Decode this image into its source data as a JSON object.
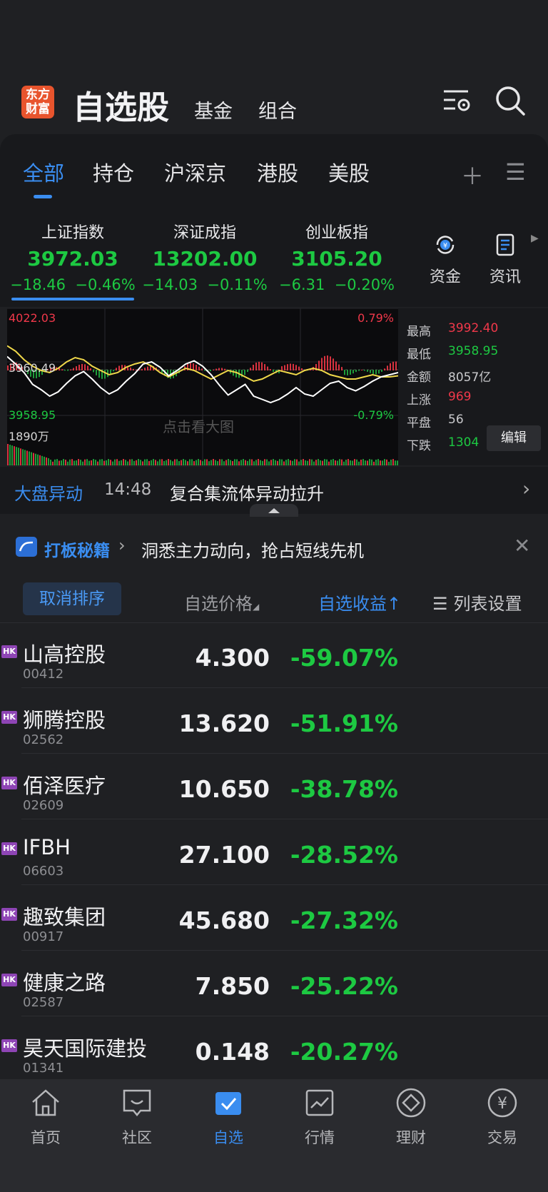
{
  "header": {
    "logo_line1": "东方",
    "logo_line2": "财富",
    "title": "自选股",
    "link_fund": "基金",
    "link_portfolio": "组合"
  },
  "tabs": [
    "全部",
    "持仓",
    "沪深京",
    "港股",
    "美股"
  ],
  "indices": [
    {
      "name": "上证指数",
      "value": "3972.03",
      "chg": "−18.46",
      "pct": "−0.46%"
    },
    {
      "name": "深证成指",
      "value": "13202.00",
      "chg": "−14.03",
      "pct": "−0.11%"
    },
    {
      "name": "创业板指",
      "value": "3105.20",
      "chg": "−6.31",
      "pct": "−0.20%"
    }
  ],
  "quick": [
    {
      "label": "资金",
      "icon": "yuan-refresh-icon"
    },
    {
      "label": "资讯",
      "icon": "news-icon"
    }
  ],
  "chart": {
    "high_label": "4022.03",
    "high_pct": "0.79%",
    "mid_label": "3960.49",
    "low_label": "3958.95",
    "low_pct": "-0.79%",
    "volume_label": "1890万",
    "watermark": "点击看大图",
    "white_line": [
      45,
      52,
      60,
      71,
      76,
      82,
      78,
      70,
      63,
      59,
      66,
      74,
      80,
      76,
      68,
      61,
      52,
      50,
      55,
      63,
      58,
      52,
      49,
      54,
      62,
      72,
      81,
      76,
      71,
      82,
      85,
      88,
      85,
      80,
      74,
      80,
      82,
      76,
      70,
      68,
      74,
      77,
      73,
      68,
      64,
      62,
      60
    ],
    "yellow_line": [
      65,
      70,
      78,
      84,
      88,
      90,
      86,
      80,
      76,
      78,
      84,
      88,
      92,
      90,
      85,
      82,
      80,
      84,
      90,
      94,
      90,
      86,
      88,
      92,
      96,
      92,
      88,
      90,
      94,
      98,
      96,
      92,
      88,
      90,
      92,
      88,
      86,
      88,
      92,
      94,
      96,
      96,
      94,
      92,
      94,
      94,
      93
    ]
  },
  "stats": [
    {
      "label": "最高",
      "value": "3992.40",
      "color": "#f0384a"
    },
    {
      "label": "最低",
      "value": "3958.95",
      "color": "#1dc942"
    },
    {
      "label": "金额",
      "value": "8057亿",
      "color": "#c9c9cc"
    },
    {
      "label": "上涨",
      "value": "969",
      "color": "#f0384a"
    },
    {
      "label": "平盘",
      "value": "56",
      "color": "#c9c9cc"
    },
    {
      "label": "下跌",
      "value": "1304",
      "color": "#1dc942"
    }
  ],
  "edit_label": "编辑",
  "alert": {
    "tag": "大盘异动",
    "time": "14:48",
    "text": "复合集流体异动拉升"
  },
  "promo": {
    "title": "打板秘籍",
    "text": "洞悉主力动向，抢占短线先机"
  },
  "list_head": {
    "cancel": "取消排序",
    "price": "自选价格",
    "gain": "自选收益↑",
    "settings": "列表设置"
  },
  "stocks": [
    {
      "badge": "HK",
      "name": "山高控股",
      "code": "00412",
      "price": "4.300",
      "pct": "-59.07%"
    },
    {
      "badge": "HK",
      "name": "狮腾控股",
      "code": "02562",
      "price": "13.620",
      "pct": "-51.91%"
    },
    {
      "badge": "HK",
      "name": "佰泽医疗",
      "code": "02609",
      "price": "10.650",
      "pct": "-38.78%"
    },
    {
      "badge": "HK",
      "name": "IFBH",
      "code": "06603",
      "price": "27.100",
      "pct": "-28.52%"
    },
    {
      "badge": "HK",
      "name": "趣致集团",
      "code": "00917",
      "price": "45.680",
      "pct": "-27.32%"
    },
    {
      "badge": "HK",
      "name": "健康之路",
      "code": "02587",
      "price": "7.850",
      "pct": "-25.22%"
    },
    {
      "badge": "HK",
      "name": "昊天国际建投",
      "code": "01341",
      "price": "0.148",
      "pct": "-20.27%"
    }
  ],
  "nav": [
    {
      "label": "首页",
      "icon": "home-icon"
    },
    {
      "label": "社区",
      "icon": "community-icon"
    },
    {
      "label": "自选",
      "icon": "watchlist-icon"
    },
    {
      "label": "行情",
      "icon": "market-icon"
    },
    {
      "label": "理财",
      "icon": "wealth-icon"
    },
    {
      "label": "交易",
      "icon": "trade-icon"
    }
  ],
  "colors": {
    "accent": "#3a8df0",
    "down": "#1dc942",
    "up": "#f0384a",
    "hk_badge": "#8e45b5"
  }
}
